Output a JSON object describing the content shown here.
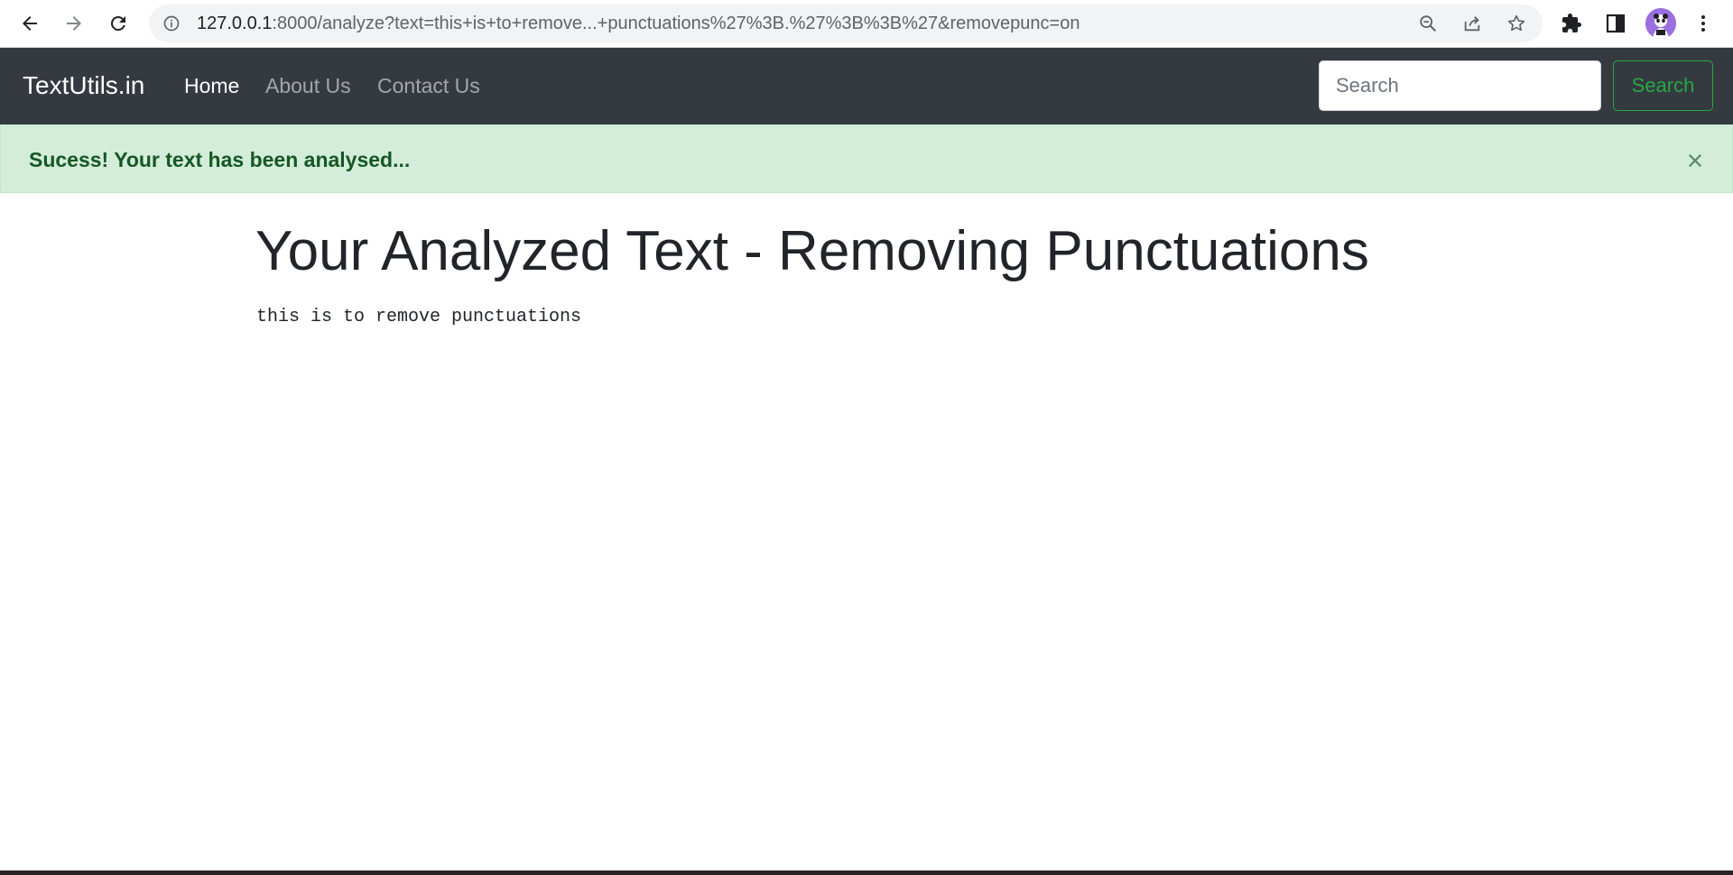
{
  "browser": {
    "url_host": "127.0.0.1",
    "url_rest": ":8000/analyze?text=this+is+to+remove...+punctuations%27%3B.%27%3B%3B%27&removepunc=on",
    "icons": [
      "back-arrow-icon",
      "forward-arrow-icon",
      "reload-icon",
      "site-info-icon",
      "zoom-out-icon",
      "share-icon",
      "star-icon",
      "extensions-icon",
      "side-panel-icon",
      "profile-avatar",
      "more-vert-icon"
    ]
  },
  "navbar": {
    "brand": "TextUtils.in",
    "links": [
      {
        "label": "Home",
        "active": true
      },
      {
        "label": "About Us",
        "active": false
      },
      {
        "label": "Contact Us",
        "active": false
      }
    ],
    "search_placeholder": "Search",
    "search_button": "Search"
  },
  "alert": {
    "strong": "Sucess!",
    "message": " Your text has been analysed..."
  },
  "main": {
    "title": "Your Analyzed Text - Removing Punctuations",
    "analyzed_text": "this is to remove punctuations"
  },
  "colors": {
    "navbar_bg": "#343a40",
    "alert_bg": "#d4edda",
    "alert_text": "#155724",
    "success": "#28a745"
  }
}
